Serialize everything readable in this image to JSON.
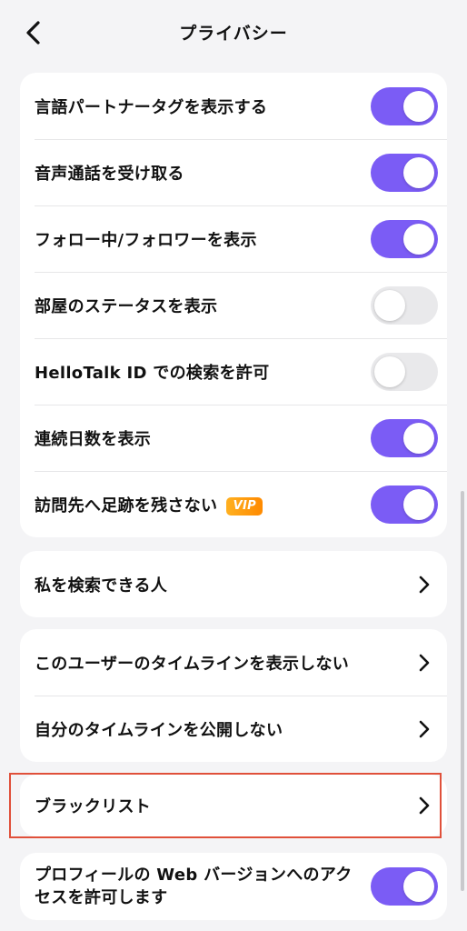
{
  "header": {
    "title": "プライバシー"
  },
  "toggles": [
    {
      "label": "言語パートナータグを表示する",
      "on": true
    },
    {
      "label": "音声通話を受け取る",
      "on": true
    },
    {
      "label": "フォロー中/フォロワーを表示",
      "on": true
    },
    {
      "label": "部屋のステータスを表示",
      "on": false
    },
    {
      "label": "HelloTalk ID での検索を許可",
      "on": false
    },
    {
      "label": "連続日数を表示",
      "on": true
    },
    {
      "label": "訪問先へ足跡を残さない",
      "on": true,
      "badge": "VIP"
    }
  ],
  "search_section": {
    "who_can_find_me": "私を検索できる人"
  },
  "timeline_section": {
    "hide_user_timeline": "このユーザーのタイムラインを表示しない",
    "hide_my_timeline": "自分のタイムラインを公開しない"
  },
  "blacklist_section": {
    "blacklist": "ブラックリスト"
  },
  "web_section": {
    "label": "プロフィールの Web バージョンへのアクセスを許可します",
    "on": true
  },
  "colors": {
    "accent": "#7b5cf5",
    "toggle_off": "#e9e9eb",
    "highlight": "#e0503a",
    "vip_badge": "#ffa010"
  },
  "icons": {
    "back": "chevron-left-icon",
    "row_arrow": "chevron-right-icon"
  }
}
